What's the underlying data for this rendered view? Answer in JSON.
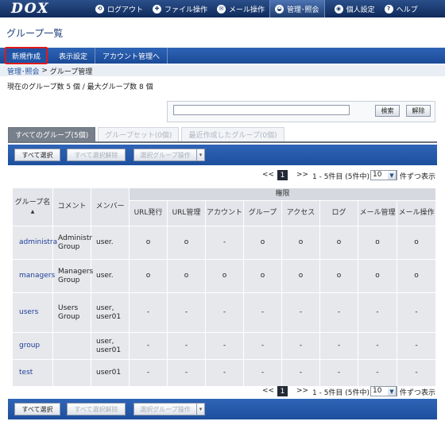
{
  "nav": {
    "logo": "DOX",
    "items": [
      {
        "icon": "⟲",
        "label": "ログアウト"
      },
      {
        "icon": "✚",
        "label": "ファイル操作"
      },
      {
        "icon": "✉",
        "label": "メール操作"
      },
      {
        "icon": "◒",
        "label": "管理･照会"
      },
      {
        "icon": "◉",
        "label": "個人設定"
      },
      {
        "icon": "?",
        "label": "ヘルプ"
      }
    ]
  },
  "page_title": "グループ一覧",
  "actions": {
    "create": "新規作成",
    "display": "表示設定",
    "account": "アカウント管理へ"
  },
  "breadcrumb": {
    "link": "管理･照会",
    "sep": " > ",
    "current": "グループ管理"
  },
  "count_info": "現在のグループ数 5 個 / 最大グループ数 8 個",
  "search": {
    "value": "",
    "search_label": "検索",
    "clear_label": "解除"
  },
  "tabs": [
    "すべてのグループ(5個)",
    "グループセット(0個)",
    "最近作成したグループ(0個)"
  ],
  "toolbar": {
    "select_all": "すべて選択",
    "deselect_all": "すべて選択解除",
    "group_op": "選択グループ操作",
    "caret": "▾"
  },
  "pager": {
    "prev": "<<",
    "current": "1",
    "next": ">>",
    "range": "1 - 5件目 (5件中)",
    "per_page": "10",
    "per_page_suffix": "件ずつ表示",
    "dropdown": "▼"
  },
  "table": {
    "permissions_header": "権限",
    "headers": {
      "name": "グループ名",
      "comment": "コメント",
      "members": "メンバー",
      "perms": [
        "URL発行",
        "URL管理",
        "アカウント",
        "グループ",
        "アクセス",
        "ログ",
        "メール管理",
        "メール操作"
      ]
    },
    "sort_indicator": "▲",
    "rows": [
      {
        "name": "administra",
        "comment": "Administr\nGroup",
        "members": "user.",
        "perms": [
          "o",
          "o",
          "-",
          "o",
          "o",
          "o",
          "o",
          "o"
        ]
      },
      {
        "name": "managers",
        "comment": "Managers\nGroup",
        "members": "user.",
        "perms": [
          "o",
          "o",
          "o",
          "o",
          "o",
          "o",
          "o",
          "o"
        ]
      },
      {
        "name": "users",
        "comment": "Users\nGroup",
        "members": "user,\nuser01",
        "perms": [
          "-",
          "-",
          "-",
          "-",
          "-",
          "-",
          "-",
          "-"
        ]
      },
      {
        "name": "group",
        "comment": "",
        "members": "user,\nuser01",
        "perms": [
          "-",
          "-",
          "-",
          "-",
          "-",
          "-",
          "-",
          "-"
        ]
      },
      {
        "name": "test",
        "comment": "",
        "members": "user01",
        "perms": [
          "-",
          "-",
          "-",
          "-",
          "-",
          "-",
          "-",
          "-"
        ]
      }
    ]
  },
  "colors": {
    "nav_bg": "#0f2a5a",
    "action_bar": "#1a4a96",
    "highlight": "#e01818",
    "link": "#1f3f9a"
  }
}
